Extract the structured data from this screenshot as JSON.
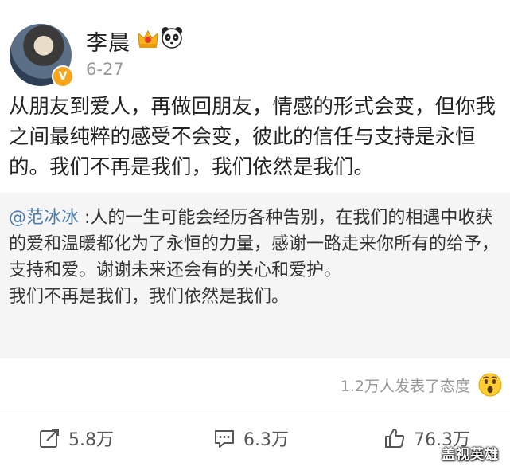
{
  "header": {
    "username": "李晨",
    "date": "6-27",
    "badge_icon": "verified-v-icon",
    "badge_text": "V",
    "badge_color": "#f7a51b",
    "title_icons": [
      "crown-icon",
      "panda-icon"
    ]
  },
  "post": {
    "text": "从朋友到爱人，再做回朋友，情感的形式会变，但你我之间最纯粹的感受不会变，彼此的信任与支持是永恒的。我们不再是我们，我们依然是我们。"
  },
  "repost": {
    "author_mention": "@范冰冰",
    "text": " :人的一生可能会经历各种告别，在我们的相遇中收获的爱和温暖都化为了永恒的力量，感谢一路走来你所有的给予，支持和爱。谢谢未来还会有的关心和爱护。",
    "text_line2": "我们不再是我们，我们依然是我们。",
    "background": "#f5f5f5",
    "mention_color": "#4f7cad"
  },
  "reactions": {
    "summary": "1.2万人发表了态度",
    "emoji_icon": "surprised-emoji-icon"
  },
  "actions": {
    "share_count": "5.8万",
    "comment_count": "6.3万",
    "like_count": "76.3万"
  },
  "watermark": {
    "text": "盖视英雄"
  }
}
